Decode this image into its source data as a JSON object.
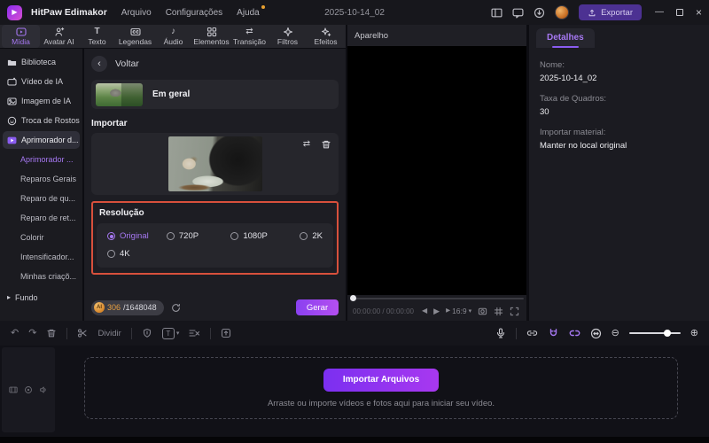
{
  "titlebar": {
    "app_name": "HitPaw Edimakor",
    "menu_items": [
      "Arquivo",
      "Configurações",
      "Ajuda"
    ],
    "project_title": "2025-10-14_02",
    "export_label": "Exportar"
  },
  "ribbon": {
    "tabs": [
      {
        "label": "Mídia",
        "active": true
      },
      {
        "label": "Avatar AI"
      },
      {
        "label": "Texto"
      },
      {
        "label": "Legendas"
      },
      {
        "label": "Áudio"
      },
      {
        "label": "Elementos"
      },
      {
        "label": "Transição"
      },
      {
        "label": "Filtros"
      },
      {
        "label": "Efeitos"
      }
    ]
  },
  "sidebar": {
    "items": [
      {
        "label": "Biblioteca"
      },
      {
        "label": "Vídeo de IA"
      },
      {
        "label": "Imagem de IA"
      },
      {
        "label": "Troca de Rostos"
      },
      {
        "label": "Aprimorador d...",
        "active": true
      }
    ],
    "subitems": [
      {
        "label": "Aprimorador ...",
        "selected": true
      },
      {
        "label": "Reparos Gerais"
      },
      {
        "label": "Reparo de qu..."
      },
      {
        "label": "Reparo de ret..."
      },
      {
        "label": "Colorir"
      },
      {
        "label": "Intensificador..."
      },
      {
        "label": "Minhas criaçõ..."
      }
    ],
    "footer_item": "Fundo"
  },
  "enhancer": {
    "back_label": "Voltar",
    "preset_label": "Em geral",
    "import_section_label": "Importar",
    "resolution": {
      "section_label": "Resolução",
      "options": [
        "Original",
        "720P",
        "1080P",
        "2K",
        "4K"
      ],
      "selected": "Original",
      "highlight_color": "#d8503c"
    },
    "ai_badge_label": "AI",
    "credits_used": "306",
    "credits_total": "/1648048",
    "generate_label": "Gerar"
  },
  "preview": {
    "header": "Aparelho",
    "time_current": "00:00:00",
    "time_separator": "/",
    "time_total": "00:00:00",
    "aspect_ratio": "16:9"
  },
  "details_panel": {
    "tab_label": "Detalhes",
    "fields": [
      {
        "label": "Nome:",
        "value": "2025-10-14_02"
      },
      {
        "label": "Taxa de Quadros:",
        "value": "30"
      },
      {
        "label": "Importar material:",
        "value": "Manter no local original"
      }
    ]
  },
  "edit_toolbar": {
    "split_label": "Dividir"
  },
  "timeline": {
    "import_button_label": "Importar Arquivos",
    "drop_hint": "Arraste ou importe vídeos e fotos aqui para iniciar seu vídeo."
  }
}
